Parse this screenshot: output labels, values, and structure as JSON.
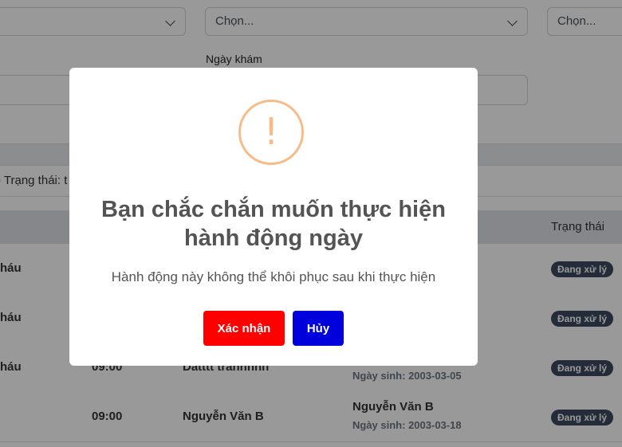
{
  "filters": {
    "select2_value": "Chọn...",
    "select3_value": "Chọn...",
    "date_label": "Ngày khám",
    "status_filter_text": "- Trạng thái: t"
  },
  "table": {
    "status_header": "Trạng thái",
    "rows": [
      {
        "name_partial": "háu",
        "time": "",
        "patient": "",
        "patient_sub": "",
        "status": "Đang xử lý"
      },
      {
        "name_partial": "háu",
        "time": "",
        "patient": "",
        "patient_sub": "",
        "status": "Đang xử lý"
      },
      {
        "name_partial": "háu",
        "time": "09:00",
        "patient": "Datttt trannnnn",
        "patient_sub": "Ngày sinh: 2003-03-05",
        "status": "Đang xử lý"
      },
      {
        "name_partial": "",
        "time": "09:00",
        "patient": "Nguyễn Văn B",
        "patient_right": "Nguyễn Văn B",
        "patient_sub": "Ngày sinh: 2003-03-18",
        "status": "Đang xử lý"
      }
    ]
  },
  "modal": {
    "icon": "warning-icon",
    "icon_glyph": "!",
    "title": "Bạn chắc chắn muốn thực hiện hành động ngày",
    "message": "Hành động này không thể khôi phục sau khi thực hiện",
    "confirm_label": "Xác nhận",
    "cancel_label": "Hủy",
    "confirm_color": "#ff0000",
    "cancel_color": "#0000dd",
    "icon_color": "#f8bb86"
  }
}
